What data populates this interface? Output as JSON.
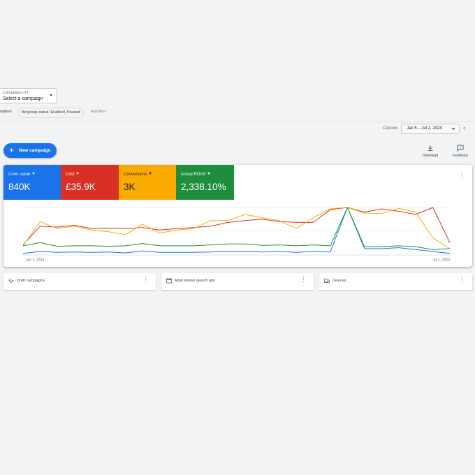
{
  "campaign_select": {
    "label": "Campaigns (7)",
    "value": "Select a campaign"
  },
  "filters": {
    "chips": [
      "nabled",
      "Ad group status: Enabled, Paused"
    ],
    "add_filter": "Add filter"
  },
  "date_range": {
    "preset": "Custom",
    "value": "Jan 5 – Jul 2, 2024"
  },
  "new_campaign": {
    "label": "New campaign"
  },
  "toolbar": {
    "download": "Download",
    "feedback": "Feedback"
  },
  "metrics": [
    {
      "label": "Conv. value",
      "value": "840K",
      "color": "#1a73e8"
    },
    {
      "label": "Cost",
      "value": "£35.9K",
      "color": "#d93025"
    },
    {
      "label": "Conversions",
      "value": "3K",
      "color": "#f9ab00"
    },
    {
      "label": "Actual ROAS",
      "value": "2,338.10%",
      "color": "#1e8e3e"
    }
  ],
  "chart_data": {
    "type": "line",
    "x_tick_labels": [
      "Jan 1, 2024",
      "Jul 1, 2024"
    ],
    "series": [
      {
        "name": "Conv. value",
        "color": "#1a73e8",
        "values": [
          2,
          6,
          4,
          5,
          4,
          5,
          3,
          7,
          4,
          4,
          4,
          5,
          6,
          6,
          5,
          6,
          4,
          6,
          5,
          100,
          12,
          12,
          14,
          10,
          6,
          2
        ]
      },
      {
        "name": "Cost",
        "color": "#d93025",
        "values": [
          20,
          60,
          58,
          62,
          55,
          56,
          55,
          57,
          52,
          55,
          57,
          60,
          68,
          72,
          75,
          70,
          68,
          68,
          95,
          100,
          90,
          97,
          92,
          85,
          100,
          25
        ]
      },
      {
        "name": "Conversions",
        "color": "#f9ab00",
        "values": [
          18,
          70,
          55,
          60,
          52,
          48,
          42,
          64,
          45,
          52,
          55,
          72,
          72,
          85,
          78,
          72,
          55,
          78,
          97,
          100,
          88,
          87,
          98,
          90,
          35,
          12
        ]
      },
      {
        "name": "Actual ROAS",
        "color": "#1e8e3e",
        "values": [
          18,
          25,
          17,
          18,
          18,
          17,
          18,
          23,
          18,
          18,
          18,
          20,
          22,
          22,
          19,
          20,
          18,
          20,
          18,
          100,
          16,
          16,
          18,
          16,
          10,
          12
        ]
      }
    ]
  },
  "bottom_cards": [
    {
      "title": "Draft campaigns",
      "icon": "edit-icon"
    },
    {
      "title": "Most shown search ads",
      "icon": "ad-icon"
    },
    {
      "title": "Devices",
      "icon": "devices-icon"
    }
  ]
}
